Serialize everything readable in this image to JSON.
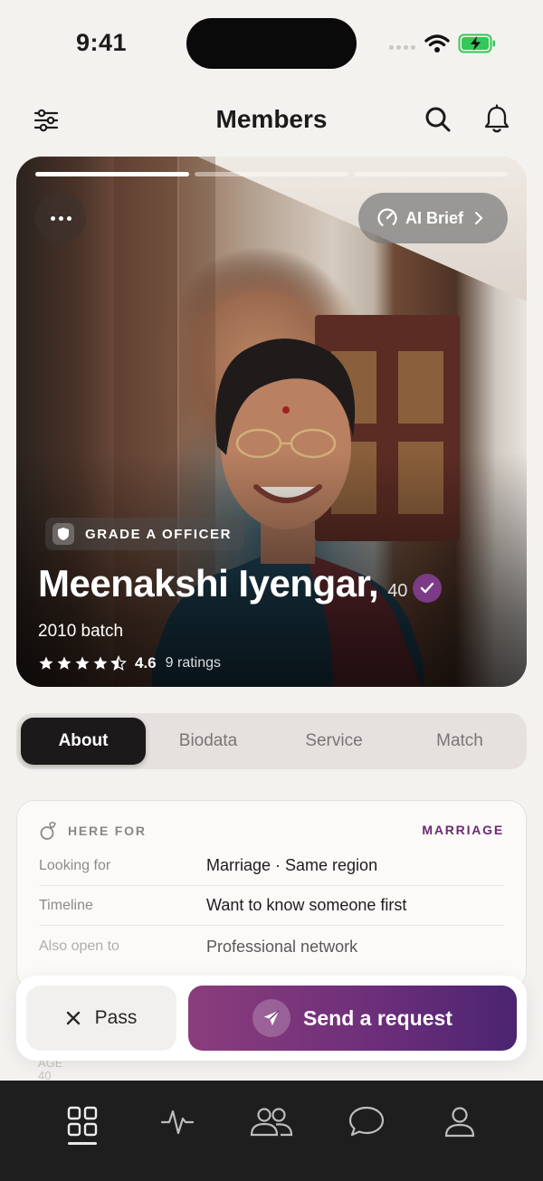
{
  "status_bar": {
    "time": "9:41"
  },
  "header": {
    "title": "Members"
  },
  "profile": {
    "ai_brief_label": "AI Brief",
    "grade_label": "GRADE A OFFICER",
    "name": "Meenakshi Iyengar,",
    "age": "40",
    "batch": "2010 batch",
    "rating": "4.6",
    "rating_fraction": 0.92,
    "ratings_count": "9 ratings",
    "photo_progress": {
      "total": 3,
      "current": 1
    }
  },
  "tabs": [
    {
      "label": "About",
      "active": true
    },
    {
      "label": "Biodata",
      "active": false
    },
    {
      "label": "Service",
      "active": false
    },
    {
      "label": "Match",
      "active": false
    }
  ],
  "info": {
    "here_for_label": "HERE FOR",
    "here_for_value": "MARRIAGE",
    "rows": [
      {
        "label": "Looking for",
        "value": "Marriage · Same region"
      },
      {
        "label": "Timeline",
        "value": "Want to know someone first"
      },
      {
        "label": "Also open to",
        "value": "Professional network"
      }
    ],
    "obscured_label": "AGE",
    "obscured_value": "40"
  },
  "actions": {
    "pass_label": "Pass",
    "send_label": "Send a request"
  },
  "nav": {
    "items": [
      {
        "icon": "grid-icon",
        "active": true
      },
      {
        "icon": "activity-icon",
        "active": false
      },
      {
        "icon": "people-icon",
        "active": false
      },
      {
        "icon": "chat-icon",
        "active": false
      },
      {
        "icon": "profile-icon",
        "active": false
      }
    ]
  },
  "colors": {
    "accent": "#7b3b86",
    "send_gradient_start": "#8a3d7c",
    "send_gradient_end": "#4b2472",
    "nav_bg": "#1e1e1e"
  }
}
